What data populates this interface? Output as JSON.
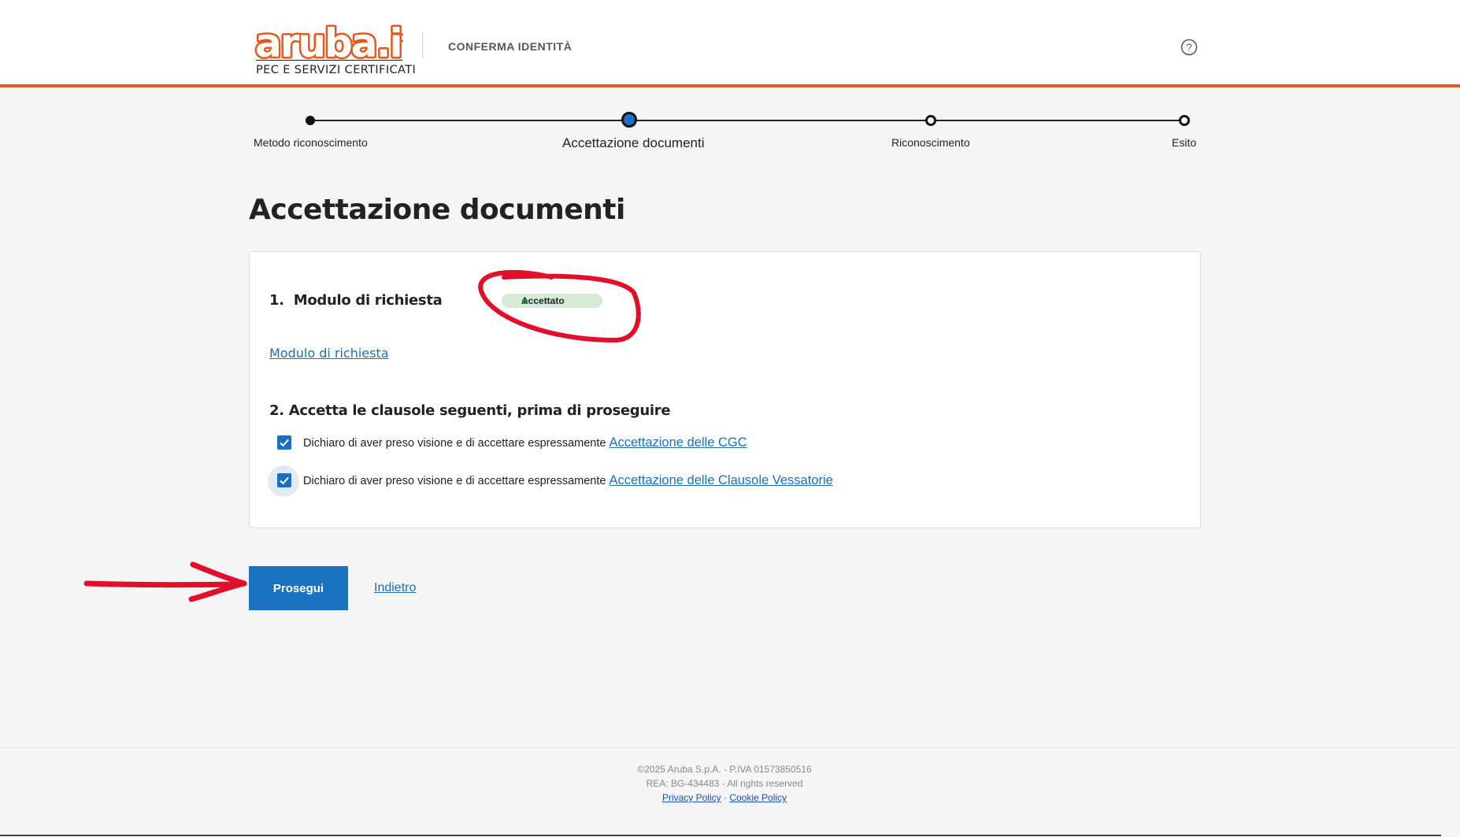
{
  "header": {
    "logo_text": "aruba.it",
    "logo_subtitle": "PEC E SERVIZI CERTIFICATI",
    "title": "CONFERMA IDENTITÀ",
    "help_icon": "help-circle-icon",
    "accent_color": "#e8561a"
  },
  "stepper": {
    "steps": [
      {
        "label": "Metodo riconoscimento",
        "state": "completed"
      },
      {
        "label": "Accettazione documenti",
        "state": "active"
      },
      {
        "label": "Riconoscimento",
        "state": "pending"
      },
      {
        "label": "Esito",
        "state": "pending"
      }
    ]
  },
  "page": {
    "title": "Accettazione documenti"
  },
  "section1": {
    "number": "1.",
    "title": "Modulo di richiesta",
    "status_badge": "Accettato",
    "link": "Modulo di richiesta"
  },
  "section2": {
    "number": "2.",
    "title": "Accetta le clausole seguenti, prima di proseguire",
    "items": [
      {
        "text": "Dichiaro di aver preso visione e di accettare espressamente",
        "link": "Accettazione delle CGC",
        "checked": true
      },
      {
        "text": "Dichiaro di aver preso visione e di accettare espressamente",
        "link": "Accettazione delle Clausole Vessatorie",
        "checked": true
      }
    ]
  },
  "actions": {
    "continue_label": "Prosegui",
    "back_label": "Indietro",
    "primary_color": "#1a72c2"
  },
  "footer": {
    "copyright": "©2025 Aruba S.p.A. - P.IVA 01573850516",
    "rea": "REA: BG-434483 - All rights reserved",
    "privacy": "Privacy Policy",
    "separator": "-",
    "cookie": "Cookie Policy"
  }
}
